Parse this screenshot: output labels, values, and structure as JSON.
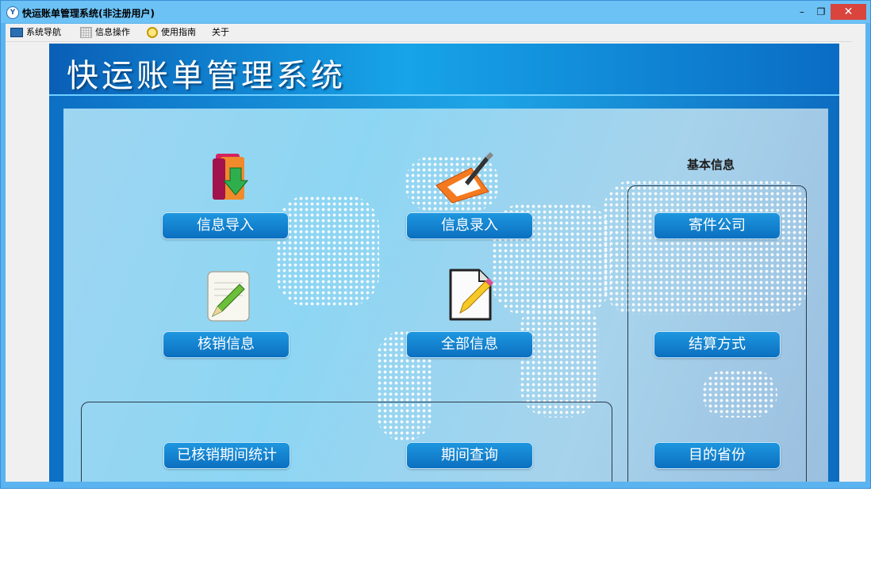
{
  "window": {
    "title": "快运账单管理系统(非注册用户)",
    "app_icon_glyph": "Y",
    "controls": {
      "minimize": "–",
      "restore": "❐",
      "close": "✕"
    }
  },
  "menu": {
    "items": [
      {
        "label": "系统导航",
        "icon": "monitor-icon"
      },
      {
        "label": "信息操作",
        "icon": "grid-icon"
      },
      {
        "label": "使用指南",
        "icon": "help-bulb-icon"
      },
      {
        "label": "关于",
        "icon": ""
      }
    ]
  },
  "header": {
    "title": "快运账单管理系统"
  },
  "tiles": {
    "import": {
      "label": "信息导入",
      "icon": "folder-download-icon"
    },
    "entry": {
      "label": "信息录入",
      "icon": "pen-write-icon"
    },
    "writeoff": {
      "label": "核销信息",
      "icon": "notepad-pencil-icon"
    },
    "all": {
      "label": "全部信息",
      "icon": "document-pencil-icon"
    },
    "period_stats": {
      "label": "已核销期间统计"
    },
    "period_query": {
      "label": "期间查询"
    }
  },
  "basic_info": {
    "title": "基本信息",
    "items": {
      "sender": "寄件公司",
      "settlement": "结算方式",
      "province": "目的省份"
    }
  },
  "colors": {
    "tile_bg": "#0b6fc0",
    "header_bg": "#17a4e8",
    "close_btn": "#d9443c"
  }
}
